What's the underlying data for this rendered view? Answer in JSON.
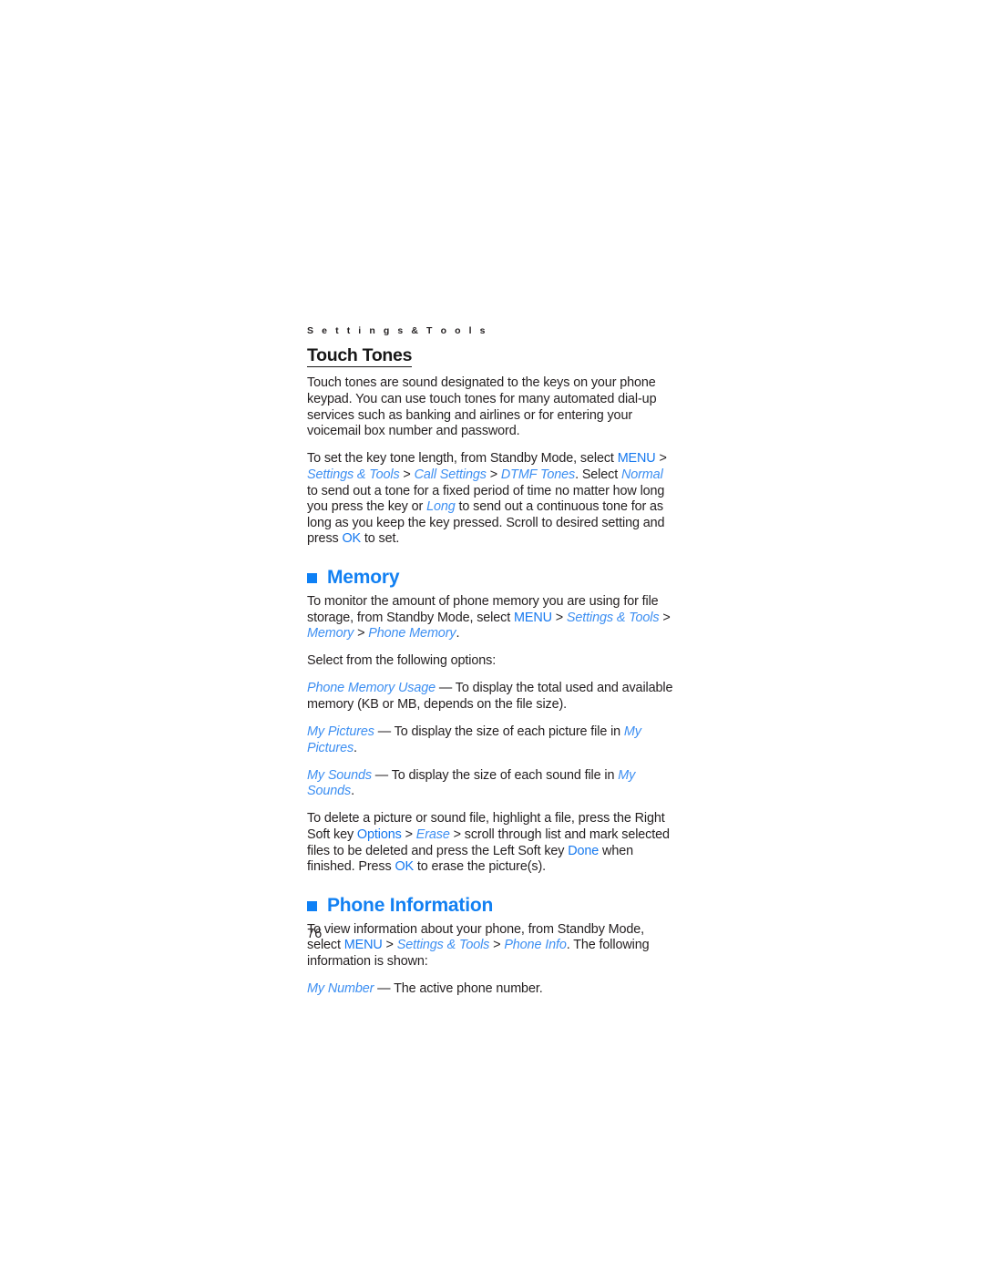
{
  "page": {
    "running_head": "S e t t i n g s   &   T o o l s",
    "folio": "76"
  },
  "sections": {
    "touch_tones": {
      "heading": "Touch Tones",
      "para1": "Touch tones are sound designated to the keys on your phone keypad. You can use touch tones for many automated dial-up services such as banking and airlines or for entering your voicemail box number and password.",
      "para2": {
        "t1": "To set the key tone length, from Standby Mode, select ",
        "menu": "MENU",
        "s1": " > ",
        "path1": "Settings & Tools",
        "s2": " > ",
        "path2": "Call Settings",
        "s3": " > ",
        "path3": "DTMF Tones",
        "t2": ". Select ",
        "em1": "Normal",
        "t3": " to send out a tone for a fixed period of time no matter how long you press the key or ",
        "em2": "Long",
        "t4": " to send out a continuous tone for as long as you keep the key pressed. Scroll to desired setting and press ",
        "ok": "OK",
        "t5": " to set."
      }
    },
    "memory": {
      "heading": "Memory",
      "bullet_icon": "square-bullet",
      "para1": {
        "t1": "To monitor the amount of phone memory you are using for file storage, from Standby Mode, select ",
        "menu": "MENU",
        "s1": " > ",
        "path1": "Settings & Tools",
        "s2": " > ",
        "path2": "Memory",
        "s3": " > ",
        "path3": "Phone Memory",
        "t2": "."
      },
      "para2": "Select from the following options:",
      "option1": {
        "label": "Phone Memory Usage",
        "text": " — To display the total used and available memory (KB or MB, depends on the file size)."
      },
      "option2": {
        "label": "My Pictures",
        "text1": " — To display the size of each picture file in ",
        "label2": "My Pictures",
        "text2": "."
      },
      "option3": {
        "label": "My Sounds",
        "text1": " — To display the size of each sound file in ",
        "label2": "My Sounds",
        "text2": "."
      },
      "para3": {
        "t1": "To delete a picture or sound file, highlight a file, press the Right Soft key ",
        "options": "Options",
        "s1": " > ",
        "erase": "Erase",
        "t2": " > scroll through list and mark selected files to be deleted and press the Left Soft key ",
        "done": "Done",
        "t3": " when finished. Press ",
        "ok": "OK",
        "t4": " to erase the picture(s)."
      }
    },
    "phone_information": {
      "heading": "Phone Information",
      "bullet_icon": "square-bullet",
      "para1": {
        "t1": "To view information about your phone, from Standby Mode, select ",
        "menu": "MENU",
        "s1": " > ",
        "path1": "Settings & Tools",
        "s2": " > ",
        "path2": "Phone Info",
        "t2": ". The following information is shown:"
      },
      "option1": {
        "label": "My Number",
        "text": " — The active phone number."
      }
    }
  },
  "colors": {
    "link_blue": "#3d8ff2",
    "ui_blue": "#1578ef",
    "heading_blue": "#1280f2",
    "body_black": "#231f20"
  }
}
